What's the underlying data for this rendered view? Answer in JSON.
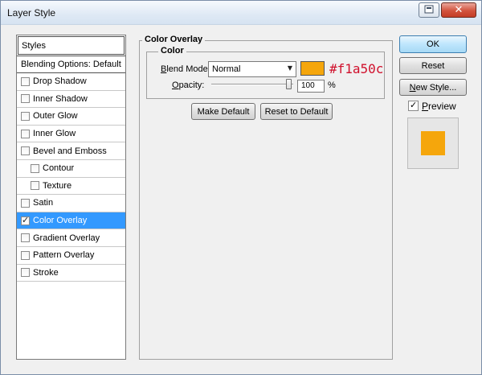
{
  "window": {
    "title": "Layer Style"
  },
  "styles_list": {
    "header": "Styles",
    "items": [
      {
        "label": "Blending Options: Default",
        "checkbox": false,
        "checked": false,
        "sub": false,
        "selected": false
      },
      {
        "label": "Drop Shadow",
        "checkbox": true,
        "checked": false,
        "sub": false,
        "selected": false
      },
      {
        "label": "Inner Shadow",
        "checkbox": true,
        "checked": false,
        "sub": false,
        "selected": false
      },
      {
        "label": "Outer Glow",
        "checkbox": true,
        "checked": false,
        "sub": false,
        "selected": false
      },
      {
        "label": "Inner Glow",
        "checkbox": true,
        "checked": false,
        "sub": false,
        "selected": false
      },
      {
        "label": "Bevel and Emboss",
        "checkbox": true,
        "checked": false,
        "sub": false,
        "selected": false
      },
      {
        "label": "Contour",
        "checkbox": true,
        "checked": false,
        "sub": true,
        "selected": false
      },
      {
        "label": "Texture",
        "checkbox": true,
        "checked": false,
        "sub": true,
        "selected": false
      },
      {
        "label": "Satin",
        "checkbox": true,
        "checked": false,
        "sub": false,
        "selected": false
      },
      {
        "label": "Color Overlay",
        "checkbox": true,
        "checked": true,
        "sub": false,
        "selected": true
      },
      {
        "label": "Gradient Overlay",
        "checkbox": true,
        "checked": false,
        "sub": false,
        "selected": false
      },
      {
        "label": "Pattern Overlay",
        "checkbox": true,
        "checked": false,
        "sub": false,
        "selected": false
      },
      {
        "label": "Stroke",
        "checkbox": true,
        "checked": false,
        "sub": false,
        "selected": false
      }
    ]
  },
  "color_overlay": {
    "group_title": "Color Overlay",
    "color_group_title": "Color",
    "blend_mode_label_first": "B",
    "blend_mode_label_rest": "lend Mode:",
    "blend_mode_value": "Normal",
    "swatch_color": "#f5a60c",
    "hex_annotation": "#f1a50c",
    "hex_annotation_color": "#d0102c",
    "opacity_label_first": "O",
    "opacity_label_rest": "pacity:",
    "opacity_value": "100",
    "opacity_fraction": 1.0,
    "opacity_unit": "%",
    "make_default_label": "Make Default",
    "reset_default_label": "Reset to Default"
  },
  "actions": {
    "ok_label": "OK",
    "reset_label": "Reset",
    "new_style_first": "N",
    "new_style_rest": "ew Style...",
    "preview_first": "P",
    "preview_rest": "review",
    "preview_checked": true,
    "preview_color": "#f5a60c"
  }
}
